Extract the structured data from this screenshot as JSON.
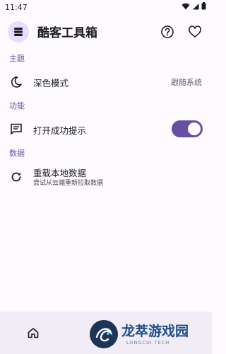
{
  "status_bar": {
    "time": "11:47"
  },
  "app_bar": {
    "title": "酷客工具箱",
    "icons": [
      "layers-icon",
      "help-circle-icon",
      "heart-outline-icon"
    ]
  },
  "sections": [
    {
      "header": "主题",
      "rows": [
        {
          "icon": "moon-icon",
          "label": "深色模式",
          "value": "跟随系统"
        }
      ]
    },
    {
      "header": "功能",
      "rows": [
        {
          "icon": "message-icon",
          "label": "打开成功提示",
          "toggle": true
        }
      ]
    },
    {
      "header": "数据",
      "rows": [
        {
          "icon": "refresh-icon",
          "label": "重载本地数据",
          "subtitle": "尝试从云端重新拉取数据"
        }
      ]
    }
  ],
  "bottom_nav": {
    "items": [
      {
        "icon": "home-icon"
      }
    ]
  },
  "watermark": {
    "title": "龙萃游戏园",
    "subtitle": "LONGCUI.TECH"
  },
  "colors": {
    "accent": "#6750a4",
    "background": "#fdfbff",
    "nav_background": "#f2ecf6",
    "logo_background": "#e8ddff"
  }
}
